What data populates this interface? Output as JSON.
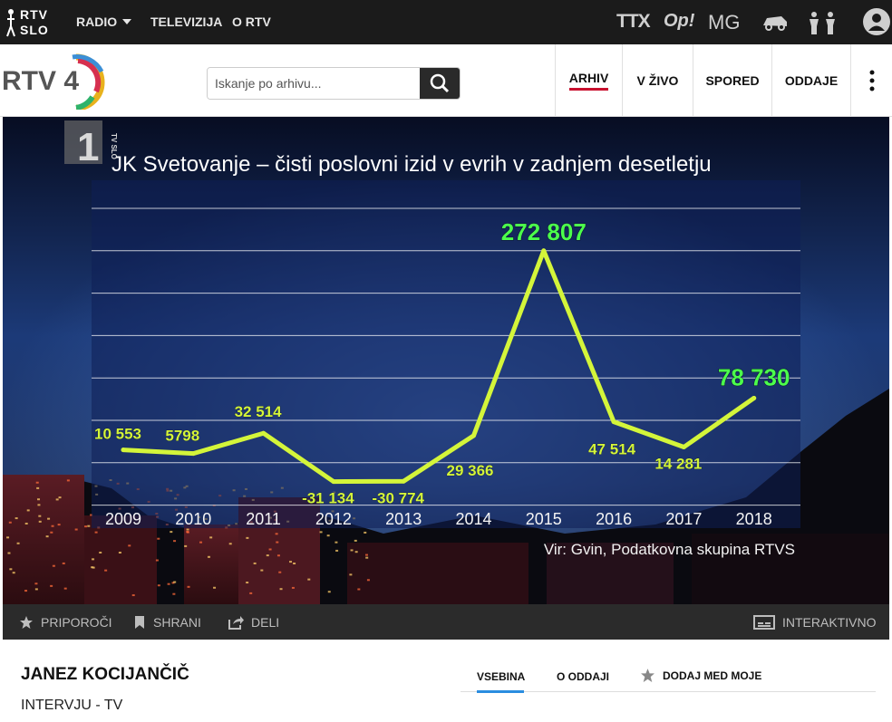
{
  "topbar": {
    "brand": {
      "line1": "RTV",
      "line2": "SLO"
    },
    "nav": [
      {
        "label": "RADIO"
      },
      {
        "label": "TELEVIZIJA"
      },
      {
        "label": "O RTV"
      }
    ],
    "icons": [
      {
        "name": "ttx-icon",
        "label": "TTX"
      },
      {
        "name": "op-icon",
        "label": "Op!"
      },
      {
        "name": "mg-icon",
        "label": "MG"
      },
      {
        "name": "zkp-icon",
        "label": "ŽKP"
      },
      {
        "name": "accessibility-icon",
        "label": ""
      },
      {
        "name": "user-icon",
        "label": ""
      }
    ]
  },
  "header": {
    "logo_text": "RTV 4",
    "search_placeholder": "Iskanje po arhivu...",
    "nav": [
      {
        "label": "ARHIV",
        "active": true
      },
      {
        "label": "V ŽIVO",
        "active": false
      },
      {
        "label": "SPORED",
        "active": false
      },
      {
        "label": "ODDAJE",
        "active": false
      }
    ]
  },
  "player": {
    "channel_logo": "1",
    "channel_sub": "TV SLO",
    "source": "Vir: Gvin, Podatkovna skupina RTVS",
    "controls": [
      {
        "label": "PRIPOROČI",
        "icon": "star-icon"
      },
      {
        "label": "SHRANI",
        "icon": "bookmark-icon"
      },
      {
        "label": "DELI",
        "icon": "share-icon"
      }
    ],
    "interactive_label": "INTERAKTIVNO"
  },
  "chart_data": {
    "type": "line",
    "title": "JK Svetovanje – čisti poslovni izid v evrih v zadnjem desetletju",
    "categories": [
      "2009",
      "2010",
      "2011",
      "2012",
      "2013",
      "2014",
      "2015",
      "2016",
      "2017",
      "2018"
    ],
    "values": [
      10553,
      5798,
      32514,
      -31134,
      -30774,
      29366,
      272807,
      47514,
      14281,
      78730
    ],
    "labels": [
      "10 553",
      "5798",
      "32 514",
      "-31 134",
      "-30 774",
      "29 366",
      "272 807",
      "47 514",
      "14 281",
      "78 730"
    ],
    "ylim": [
      -40000,
      300000
    ],
    "grid": true,
    "line_color": "#d4f53a",
    "highlight_color": "#4cff4c"
  },
  "info": {
    "person": "JANEZ KOCIJANČIČ",
    "show": "INTERVJU - TV",
    "tabs": [
      {
        "label": "VSEBINA",
        "active": true
      },
      {
        "label": "O ODDAJI",
        "active": false
      },
      {
        "label": "DODAJ MED MOJE",
        "active": false
      }
    ]
  }
}
